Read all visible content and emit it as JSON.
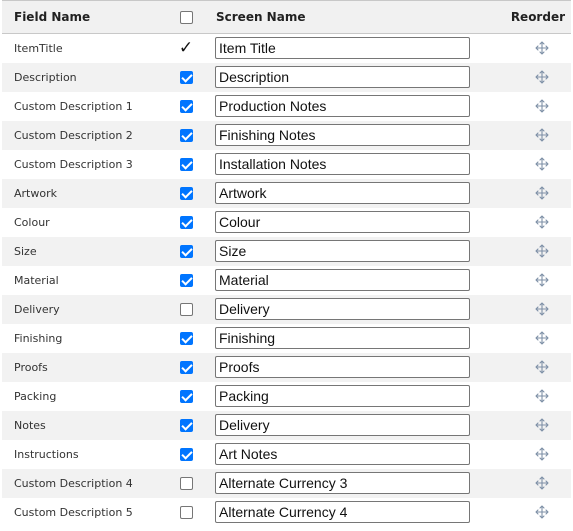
{
  "header": {
    "field_name": "Field Name",
    "screen_name": "Screen Name",
    "reorder": "Reorder"
  },
  "rows": [
    {
      "field": "ItemTitle",
      "state": "locked",
      "screen": "Item Title"
    },
    {
      "field": "Description",
      "state": "checked",
      "screen": "Description"
    },
    {
      "field": "Custom Description 1",
      "state": "checked",
      "screen": "Production Notes"
    },
    {
      "field": "Custom Description 2",
      "state": "checked",
      "screen": "Finishing Notes"
    },
    {
      "field": "Custom Description 3",
      "state": "checked",
      "screen": "Installation Notes"
    },
    {
      "field": "Artwork",
      "state": "checked",
      "screen": "Artwork"
    },
    {
      "field": "Colour",
      "state": "checked",
      "screen": "Colour"
    },
    {
      "field": "Size",
      "state": "checked",
      "screen": "Size"
    },
    {
      "field": "Material",
      "state": "checked",
      "screen": "Material"
    },
    {
      "field": "Delivery",
      "state": "unchecked",
      "screen": "Delivery"
    },
    {
      "field": "Finishing",
      "state": "checked",
      "screen": "Finishing"
    },
    {
      "field": "Proofs",
      "state": "checked",
      "screen": "Proofs"
    },
    {
      "field": "Packing",
      "state": "checked",
      "screen": "Packing"
    },
    {
      "field": "Notes",
      "state": "checked",
      "screen": "Delivery"
    },
    {
      "field": "Instructions",
      "state": "checked",
      "screen": "Art Notes"
    },
    {
      "field": "Custom Description 4",
      "state": "unchecked",
      "screen": "Alternate Currency 3"
    },
    {
      "field": "Custom Description 5",
      "state": "unchecked",
      "screen": "Alternate Currency 4"
    }
  ],
  "icons": {
    "locked_mark": "✓",
    "reorder_icon": "move-arrows-icon",
    "checkbox_color": "#0075ff",
    "reorder_color": "#7d8fa6"
  }
}
